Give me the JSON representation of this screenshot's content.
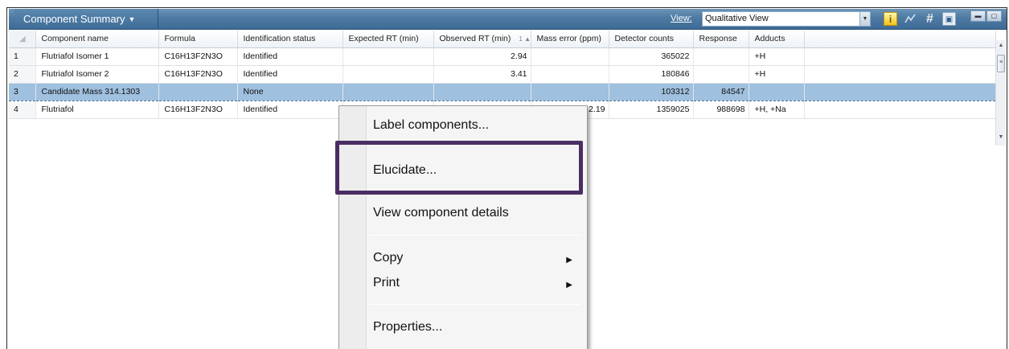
{
  "panel": {
    "title": "Component Summary",
    "view_label": "View:",
    "view_value": "Qualitative View"
  },
  "toolbar_icons": [
    "info-icon",
    "chart-icon",
    "hash-icon",
    "doc-icon"
  ],
  "table": {
    "corner": "◢",
    "columns": [
      "Component name",
      "Formula",
      "Identification status",
      "Expected RT (min)",
      "Observed RT (min)",
      "Mass error (ppm)",
      "Detector counts",
      "Response",
      "Adducts"
    ],
    "sort_indicator": "1 ▲",
    "rows": [
      {
        "num": "1",
        "name": "Flutriafol Isomer 1",
        "formula": "C16H13F2N3O",
        "status": "Identified",
        "expected_rt": "",
        "observed_rt": "2.94",
        "mass_error": "",
        "detector_counts": "365022",
        "response": "",
        "adducts": "+H"
      },
      {
        "num": "2",
        "name": "Flutriafol Isomer 2",
        "formula": "C16H13F2N3O",
        "status": "Identified",
        "expected_rt": "",
        "observed_rt": "3.41",
        "mass_error": "",
        "detector_counts": "180846",
        "response": "",
        "adducts": "+H"
      },
      {
        "num": "3",
        "name": "Candidate Mass 314.1303",
        "formula": "",
        "status": "None",
        "expected_rt": "",
        "observed_rt": "",
        "mass_error": "",
        "detector_counts": "103312",
        "response": "84547",
        "adducts": ""
      },
      {
        "num": "4",
        "name": "Flutriafol",
        "formula": "C16H13F2N3O",
        "status": "Identified",
        "expected_rt": "",
        "observed_rt": "",
        "mass_error": "2.19",
        "detector_counts": "1359025",
        "response": "988698",
        "adducts": "+H, +Na"
      }
    ]
  },
  "context_menu": {
    "label_components": "Label components...",
    "elucidate": "Elucidate...",
    "view_details": "View component details",
    "copy": "Copy",
    "print": "Print",
    "properties": "Properties...",
    "submenu_arrow": "▶"
  },
  "colors": {
    "header_blue": "#4d7aa3",
    "selected_row": "#9fc0de",
    "highlight_box": "#4a2e63"
  }
}
